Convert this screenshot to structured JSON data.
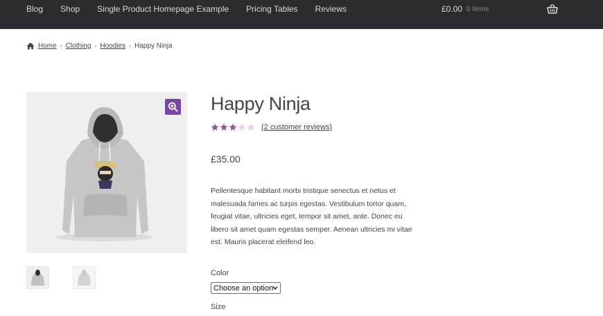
{
  "header": {
    "nav": [
      {
        "label": "Blog"
      },
      {
        "label": "Shop"
      },
      {
        "label": "Single Product Homepage Example"
      },
      {
        "label": "Pricing Tables"
      },
      {
        "label": "Reviews"
      }
    ],
    "cart_total": "£0.00",
    "cart_count": "0 items",
    "cart_icon": "basket-icon"
  },
  "breadcrumb": {
    "items": [
      "Home",
      "Clothing",
      "Hoodies"
    ],
    "current": "Happy Ninja",
    "separator": "›",
    "home_icon": "home-icon"
  },
  "product": {
    "title": "Happy Ninja",
    "rating": 3,
    "rating_max": 5,
    "reviews_link": "(2 customer reviews)",
    "price": "£35.00",
    "description": "Pellentesque habitant morbi tristique senectus et netus et malesuada fames ac turpis egestas. Vestibulum tortor quam, feugiat vitae, ultricies eget, tempor sit amet, ante. Donec eu libero sit amet quam egestas semper. Aenean ultricies mi vitae est. Mauris placerat eleifend leo.",
    "color_label": "Color",
    "color_select": "Choose an option",
    "size_label": "Size"
  },
  "colors": {
    "header_bg": "#2b2c30",
    "accent": "#7b45a6",
    "star_filled": "#96588a",
    "star_empty": "#e3d3e0"
  }
}
